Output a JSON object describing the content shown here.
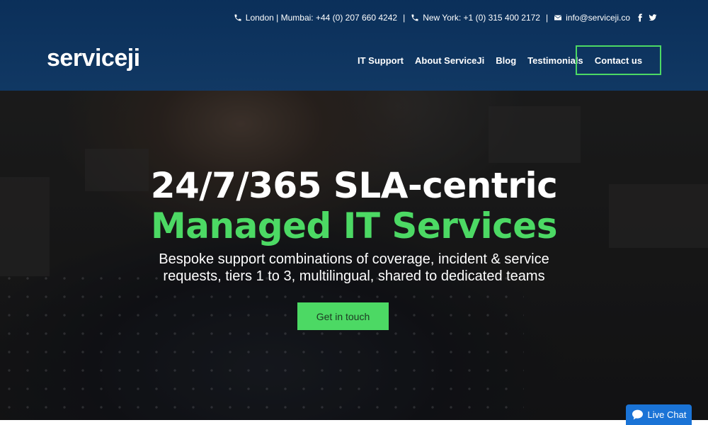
{
  "topbar": {
    "london_mumbai": "London | Mumbai: +44 (0) 207 660 4242",
    "new_york": "New York: +1 (0) 315 400 2172",
    "email": "info@serviceji.co",
    "separator": "|"
  },
  "logo": {
    "text": "serviceji"
  },
  "nav": {
    "items": [
      "IT Support",
      "About ServiceJi",
      "Blog",
      "Testimonials"
    ],
    "contact_label": "Contact us"
  },
  "hero": {
    "headline": "24/7/365 SLA-centric",
    "headline_accent": "Managed IT Services",
    "subtitle": "Bespoke support combinations of coverage, incident & service requests, tiers 1 to 3, multilingual, shared to dedicated teams",
    "cta_label": "Get in touch"
  },
  "live_chat": {
    "label": "Live Chat"
  },
  "colors": {
    "header_bg": "#0a305c",
    "accent_green": "#4cd964",
    "chat_blue": "#1a73d6"
  },
  "icons": [
    "phone-icon",
    "phone-icon",
    "envelope-icon",
    "facebook-icon",
    "twitter-icon",
    "chat-bubble-icon"
  ]
}
